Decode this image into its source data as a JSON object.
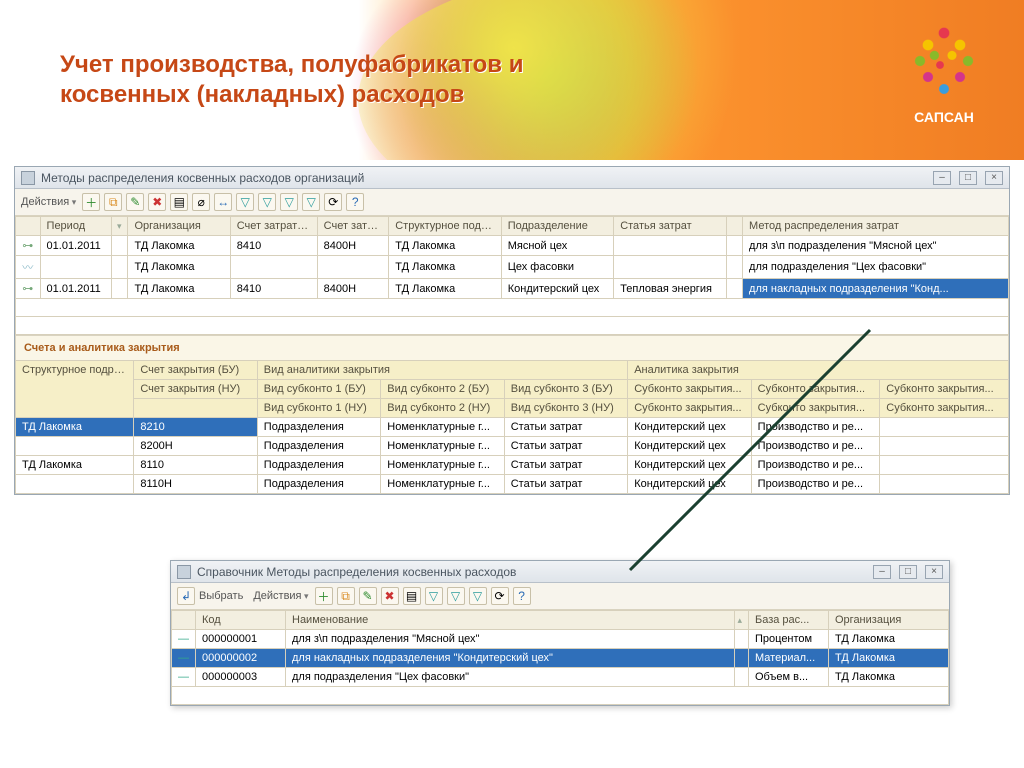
{
  "banner": {
    "title": "Учет производства, полуфабрикатов и косвенных (накладных) расходов",
    "logo_text": "САПСАН"
  },
  "main_window": {
    "title": "Методы распределения косвенных расходов организаций",
    "actions_label": "Действия",
    "columns": {
      "period": "Период",
      "org": "Организация",
      "acc_bu": "Счет затрат (БУ)",
      "acc_nu": "Счет затра...",
      "struct": "Структурное подра...",
      "dept": "Подразделение",
      "cost_item": "Статья затрат",
      "method": "Метод распределения затрат"
    },
    "rows": [
      {
        "period": "01.01.2011",
        "org": "ТД Лакомка",
        "acc_bu": "8410",
        "acc_nu": "8400Н",
        "struct": "ТД Лакомка",
        "dept": "Мясной цех",
        "cost_item": "",
        "method": "для з\\п подразделения \"Мясной цех\""
      },
      {
        "period": "",
        "org": "ТД Лакомка",
        "acc_bu": "",
        "acc_nu": "",
        "struct": "ТД Лакомка",
        "dept": "Цех фасовки",
        "cost_item": "",
        "method": "для подразделения \"Цех фасовки\""
      },
      {
        "period": "01.01.2011",
        "org": "ТД Лакомка",
        "acc_bu": "8410",
        "acc_nu": "8400Н",
        "struct": "ТД Лакомка",
        "dept": "Кондитерский цех",
        "cost_item": "Тепловая энергия",
        "method": "для накладных подразделения \"Конд...",
        "selected": true
      }
    ]
  },
  "analytics": {
    "section_title": "Счета и аналитика закрытия",
    "header_row1": {
      "struct": "Структурное подразделение",
      "acc_bu": "Счет закрытия (БУ)",
      "vid": "Вид аналитики закрытия",
      "ana": "Аналитика закрытия"
    },
    "header_row2": {
      "acc_nu": "Счет закрытия (НУ)",
      "v1": "Вид субконто 1 (БУ)",
      "v2": "Вид субконто 2 (БУ)",
      "v3": "Вид субконто 3 (БУ)",
      "s1": "Субконто закрытия...",
      "s2": "Субконто закрытия...",
      "s3": "Субконто закрытия..."
    },
    "header_row3": {
      "v1": "Вид субконто 1 (НУ)",
      "v2": "Вид субконто 2 (НУ)",
      "v3": "Вид субконто 3 (НУ)",
      "s1": "Субконто закрытия...",
      "s2": "Субконто закрытия...",
      "s3": "Субконто закрытия..."
    },
    "rows": [
      {
        "struct": "ТД Лакомка",
        "acc": "8210",
        "v1": "Подразделения",
        "v2": "Номенклатурные г...",
        "v3": "Статьи затрат",
        "s1": "Кондитерский цех",
        "s2": "Производство и ре...",
        "s3": "",
        "sel": true
      },
      {
        "struct": "",
        "acc": "8200Н",
        "v1": "Подразделения",
        "v2": "Номенклатурные г...",
        "v3": "Статьи затрат",
        "s1": "Кондитерский цех",
        "s2": "Производство и ре...",
        "s3": ""
      },
      {
        "struct": "ТД Лакомка",
        "acc": "8110",
        "v1": "Подразделения",
        "v2": "Номенклатурные г...",
        "v3": "Статьи затрат",
        "s1": "Кондитерский цех",
        "s2": "Производство и ре...",
        "s3": ""
      },
      {
        "struct": "",
        "acc": "8110Н",
        "v1": "Подразделения",
        "v2": "Номенклатурные г...",
        "v3": "Статьи затрат",
        "s1": "Кондитерский цех",
        "s2": "Производство и ре...",
        "s3": ""
      }
    ]
  },
  "sub_window": {
    "title": "Справочник Методы распределения косвенных расходов",
    "select_label": "Выбрать",
    "actions_label": "Действия",
    "columns": {
      "code": "Код",
      "name": "Наименование",
      "base": "База рас...",
      "org": "Организация"
    },
    "rows": [
      {
        "code": "000000001",
        "name": "для з\\п подразделения \"Мясной цех\"",
        "base": "Процентом",
        "org": "ТД Лакомка"
      },
      {
        "code": "000000002",
        "name": "для накладных подразделения \"Кондитерский цех\"",
        "base": "Материал...",
        "org": "ТД Лакомка",
        "sel": true
      },
      {
        "code": "000000003",
        "name": "для подразделения \"Цех фасовки\"",
        "base": "Объем в...",
        "org": "ТД Лакомка"
      }
    ]
  }
}
